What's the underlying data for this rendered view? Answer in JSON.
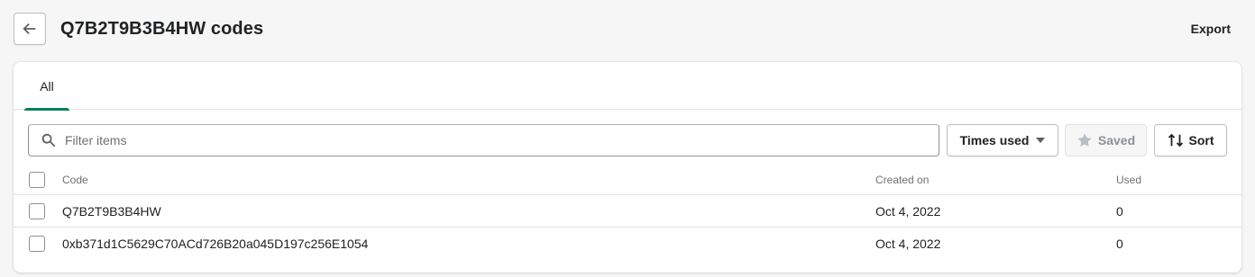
{
  "header": {
    "title": "Q7B2T9B3B4HW codes",
    "export_label": "Export",
    "back_icon": "arrow-left-icon"
  },
  "tabs": [
    {
      "label": "All",
      "selected": true
    }
  ],
  "toolbar": {
    "search_placeholder": "Filter items",
    "times_used_label": "Times used",
    "saved_label": "Saved",
    "sort_label": "Sort"
  },
  "table": {
    "columns": [
      "Code",
      "Created on",
      "Used"
    ],
    "rows": [
      {
        "code": "Q7B2T9B3B4HW",
        "created_on": "Oct 4, 2022",
        "used": "0"
      },
      {
        "code": "0xb371d1C5629C70ACd726B20a045D197c256E1054",
        "created_on": "Oct 4, 2022",
        "used": "0"
      }
    ]
  },
  "colors": {
    "accent": "#008060",
    "background": "#f6f6f7"
  }
}
